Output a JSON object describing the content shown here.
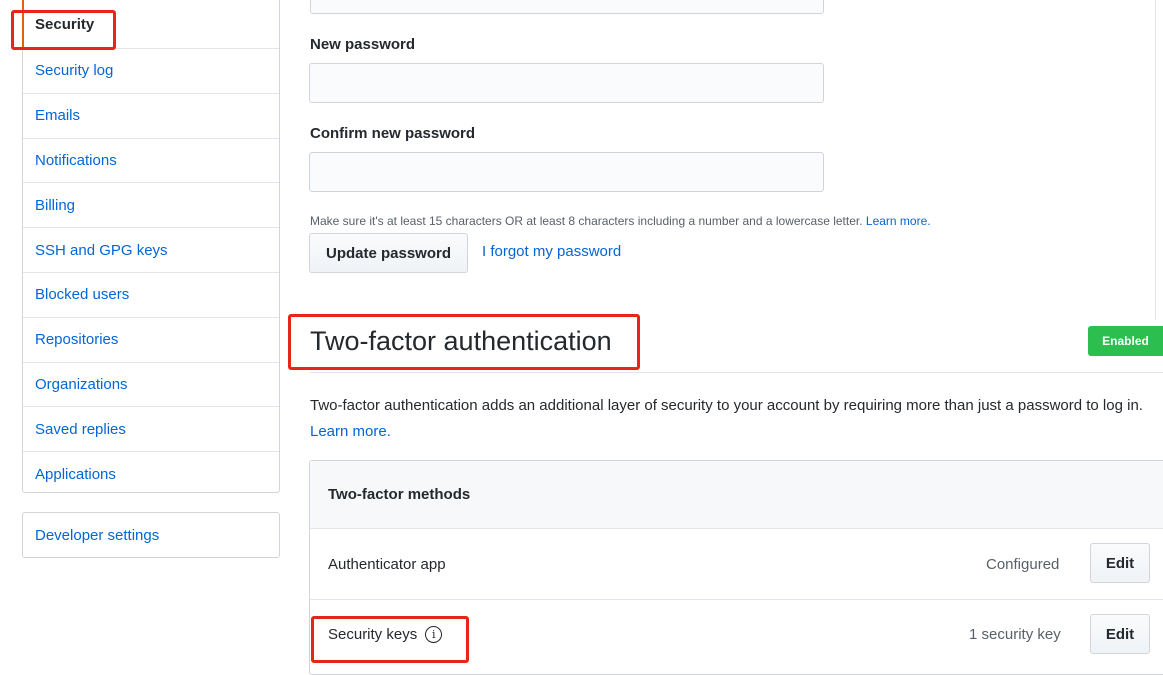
{
  "sidebar": {
    "items": [
      {
        "label": "Security"
      },
      {
        "label": "Security log"
      },
      {
        "label": "Emails"
      },
      {
        "label": "Notifications"
      },
      {
        "label": "Billing"
      },
      {
        "label": "SSH and GPG keys"
      },
      {
        "label": "Blocked users"
      },
      {
        "label": "Repositories"
      },
      {
        "label": "Organizations"
      },
      {
        "label": "Saved replies"
      },
      {
        "label": "Applications"
      }
    ],
    "developer_settings": "Developer settings"
  },
  "password": {
    "new_label": "New password",
    "confirm_label": "Confirm new password",
    "hint_text": "Make sure it's at least 15 characters OR at least 8 characters including a number and a lowercase letter.",
    "hint_link": "Learn more.",
    "update_button": "Update password",
    "forgot_link": "I forgot my password"
  },
  "two_factor": {
    "title": "Two-factor authentication",
    "badge": "Enabled",
    "description": "Two-factor authentication adds an additional layer of security to your account by requiring more than just a password to log in.",
    "learn_more": "Learn more.",
    "methods_header": "Two-factor methods",
    "methods": [
      {
        "name": "Authenticator app",
        "status": "Configured",
        "action": "Edit"
      },
      {
        "name": "Security keys",
        "status": "1 security key",
        "action": "Edit"
      }
    ],
    "info_icon": "i"
  },
  "colors": {
    "link": "#0366d6",
    "badge": "#2cbe4e",
    "highlight": "#e8251b"
  }
}
